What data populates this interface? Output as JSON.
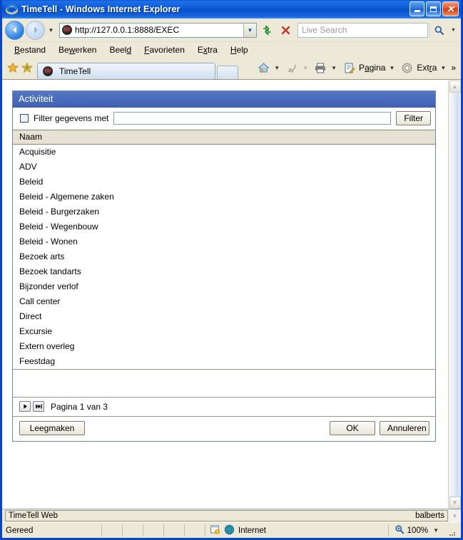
{
  "window": {
    "title": "TimeTell - Windows Internet Explorer",
    "icon": "ie-logo-icon",
    "minimize_label": "Minimaliseren",
    "maximize_label": "Maximaliseren",
    "close_label": "Sluiten"
  },
  "navigation": {
    "back_label": "Vorige",
    "forward_label": "Volgende",
    "history_dropdown_label": "Recente pagina's",
    "url": "http://127.0.0.1:8888/EXEC",
    "url_dropdown_label": "Adresgeschiedenis",
    "refresh_label": "Vernieuwen",
    "stop_label": "Stoppen",
    "site_icon_text": "tW"
  },
  "search": {
    "placeholder": "Live Search",
    "button_label": "Zoeken",
    "dropdown_label": "Zoekproviders"
  },
  "menubar": {
    "items": [
      {
        "label": "Bestand",
        "accel": "B"
      },
      {
        "label": "Bewerken",
        "accel": "w"
      },
      {
        "label": "Beeld",
        "accel": "d"
      },
      {
        "label": "Favorieten",
        "accel": "F"
      },
      {
        "label": "Extra",
        "accel": "x"
      },
      {
        "label": "Help",
        "accel": "H"
      }
    ]
  },
  "tabbar": {
    "favorites_center_label": "Favorietencentrum",
    "add_favorite_label": "Aan Favorieten toevoegen",
    "tabs": [
      {
        "label": "TimeTell",
        "favicon_text": "tW",
        "active": true
      }
    ],
    "new_tab_label": "Nieuw tabblad",
    "buttons": [
      {
        "name": "home-icon",
        "label": ""
      },
      {
        "name": "feeds-icon",
        "label": ""
      },
      {
        "name": "print-icon",
        "label": ""
      },
      {
        "name": "page-menu",
        "label": "Pagina"
      },
      {
        "name": "tools-menu",
        "label": "Extra"
      }
    ],
    "overflow_label": "»"
  },
  "panel": {
    "header": "Activiteit",
    "filter": {
      "checkbox_label": "Filter gegevens met",
      "checkbox_checked": false,
      "input_value": "",
      "input_placeholder": "",
      "button_label": "Filter"
    },
    "column_header": "Naam",
    "items": [
      "Acquisitie",
      "ADV",
      "Beleid",
      "Beleid - Algemene zaken",
      "Beleid - Burgerzaken",
      "Beleid - Wegenbouw",
      "Beleid - Wonen",
      "Bezoek arts",
      "Bezoek tandarts",
      "Bijzonder verlof",
      "Call center",
      "Direct",
      "Excursie",
      "Extern overleg",
      "Feestdag"
    ],
    "pager": {
      "next_label": "▶",
      "last_label": "▶▶|",
      "text": "Pagina 1 van 3"
    },
    "buttons": {
      "clear_label": "Leegmaken",
      "ok_label": "OK",
      "cancel_label": "Annuleren"
    }
  },
  "app_status": {
    "left": "TimeTell Web",
    "right": "balberts"
  },
  "statusbar": {
    "ready": "Gereed",
    "zone": "Internet",
    "zoom": "100%",
    "zoom_dropdown_label": "Zoomniveau wijzigen"
  },
  "colors": {
    "title_blue": "#0f5ed8",
    "window_border": "#0a46c4",
    "panel_header_blue": "#4a6cbc",
    "column_header_beige": "#e7e3d4",
    "chrome_beige": "#ece9d8"
  }
}
